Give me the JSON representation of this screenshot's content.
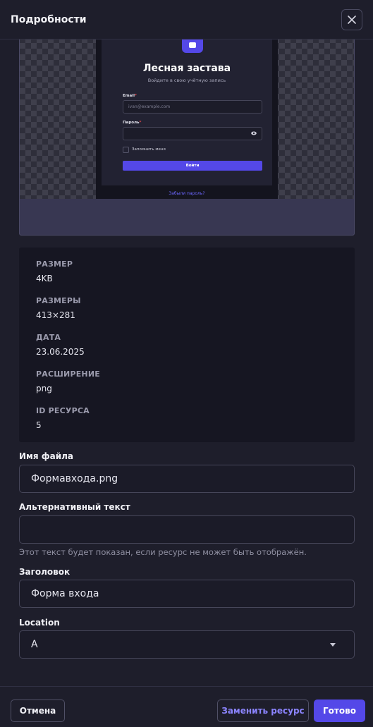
{
  "header": {
    "title": "Подробности"
  },
  "preview": {
    "title": "Лесная застава",
    "subtitle": "Войдите в свою учётную запись",
    "email_label": "Email",
    "required_mark": "*",
    "email_placeholder": "ivan@example.com",
    "password_label": "Пароль",
    "remember_label": "Запомнить меня",
    "submit_label": "Войти",
    "forgot_link": "Забыли пароль?"
  },
  "meta": {
    "size_label": "РАЗМЕР",
    "size_value": "4KB",
    "dimensions_label": "РАЗМЕРЫ",
    "dimensions_value": "413×281",
    "date_label": "ДАТА",
    "date_value": "23.06.2025",
    "extension_label": "РАСШИРЕНИЕ",
    "extension_value": "png",
    "id_label": "ID РЕСУРСА",
    "id_value": "5"
  },
  "form": {
    "filename_label": "Имя файла",
    "filename_value": "Формавхода.png",
    "alt_label": "Альтернативный текст",
    "alt_value": "",
    "alt_helper": "Этот текст будет показан, если ресурс не может быть отображён.",
    "caption_label": "Заголовок",
    "caption_value": "Форма входа",
    "location_label": "Location",
    "location_value": "A"
  },
  "footer": {
    "cancel_label": "Отмена",
    "replace_label": "Заменить ресурс",
    "done_label": "Готово"
  },
  "colors": {
    "accent": "#5448e8",
    "link": "#8b84ff",
    "required": "#e5484d"
  }
}
